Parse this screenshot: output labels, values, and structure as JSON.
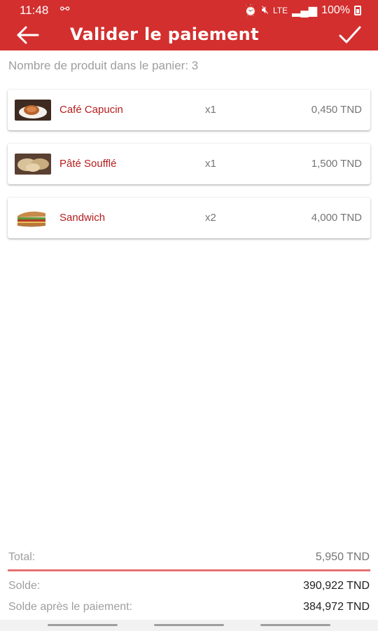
{
  "status": {
    "time": "11:48",
    "lte": "LTE",
    "battery": "100%"
  },
  "header": {
    "title": "Valider le paiement",
    "back_icon": "arrow-left-icon",
    "confirm_icon": "checkmark-icon"
  },
  "cart": {
    "count_text": "Nombre de produit dans le panier: 3",
    "items": [
      {
        "name": "Café Capucin",
        "qty": "x1",
        "price": "0,450 TND"
      },
      {
        "name": "Pâté Soufflé",
        "qty": "x1",
        "price": "1,500 TND"
      },
      {
        "name": "Sandwich",
        "qty": "x2",
        "price": "4,000 TND"
      }
    ]
  },
  "summary": {
    "total_label": "Total:",
    "total_value": "5,950 TND",
    "solde_label": "Solde:",
    "solde_value": "390,922 TND",
    "solde_after_label": "Solde après le paiement:",
    "solde_after_value": "384,972 TND"
  },
  "colors": {
    "primary": "#d32f2f",
    "item_name": "#b71c1c",
    "divider": "#e57373"
  }
}
